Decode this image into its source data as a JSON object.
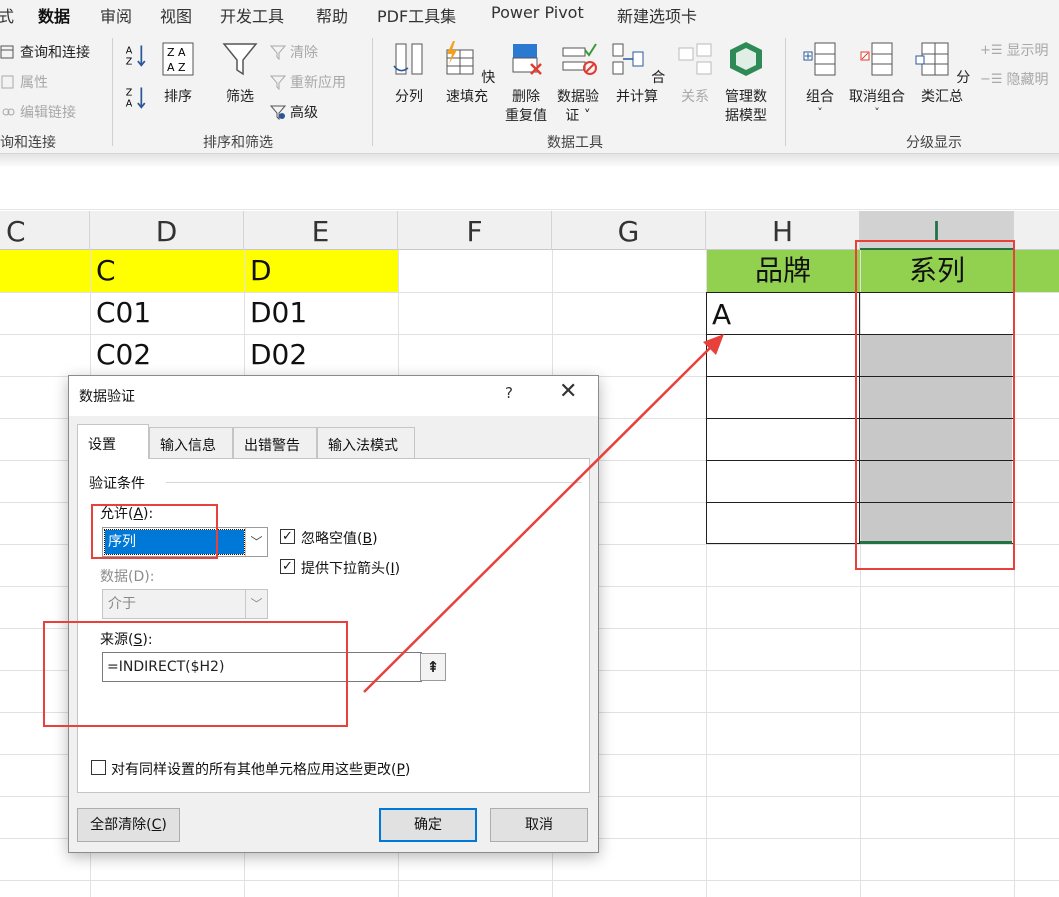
{
  "ribbon": {
    "tabs": [
      "式",
      "数据",
      "审阅",
      "视图",
      "开发工具",
      "帮助",
      "PDF工具集",
      "Power Pivot",
      "新建选项卡"
    ],
    "active_tab": "数据",
    "query_group": {
      "items": [
        "查询和连接",
        "属性",
        "编辑链接"
      ],
      "name": "询和连接"
    },
    "sort_group": {
      "sort_label": "排序",
      "filter_label": "筛选",
      "clear_label": "清除",
      "reapply_label": "重新应用",
      "advanced_label": "高级",
      "name": "排序和筛选"
    },
    "data_tools": {
      "split": "分列",
      "flash_fill": "快速填充",
      "remove_dup_1": "删除",
      "remove_dup_2": "重复值",
      "validate_1": "数据验",
      "validate_2": "证 ˅",
      "consolidate": "合并计算",
      "relations": "关系",
      "model_1": "管理数",
      "model_2": "据模型",
      "name": "数据工具"
    },
    "outline": {
      "group": "组合",
      "ungroup": "取消组合",
      "subtotal": "分类汇总",
      "show_detail": "显示明",
      "hide_detail": "隐藏明",
      "name": "分级显示"
    }
  },
  "sheet": {
    "columns": [
      "C",
      "D",
      "E",
      "F",
      "G",
      "H",
      "I"
    ],
    "selected_column": "I",
    "cells": {
      "d_header": "C",
      "e_header": "D",
      "d1": "C01",
      "e1": "D01",
      "d2": "C02",
      "e2": "D02",
      "h_header": "品牌",
      "i_header": "系列",
      "h1": "A"
    },
    "colors": {
      "yellow": "#ffff00",
      "green": "#92d050",
      "selected": "#c8c8c8",
      "accent": "#217346",
      "annotation": "#e8413b"
    }
  },
  "dialog": {
    "title": "数据验证",
    "help": "?",
    "close": "✕",
    "tabs": [
      "设置",
      "输入信息",
      "出错警告",
      "输入法模式"
    ],
    "active_tab": "设置",
    "section": "验证条件",
    "allow_label": "允许(",
    "allow_key": "A",
    "allow_end": "):",
    "allow_value": "序列",
    "data_label": "数据(D):",
    "data_value": "介于",
    "ignore_blank": "忽略空值(",
    "ignore_blank_key": "B",
    "in_cell_dropdown": "提供下拉箭头(",
    "in_cell_dropdown_key": "I",
    "source_label": "来源(",
    "source_key": "S",
    "source_value": "=INDIRECT($H2)",
    "apply_all": "对有同样设置的所有其他单元格应用这些更改(",
    "apply_all_key": "P",
    "clear_all": "全部清除(",
    "clear_all_key": "C",
    "ok": "确定",
    "cancel": "取消",
    "close_paren": ")"
  }
}
